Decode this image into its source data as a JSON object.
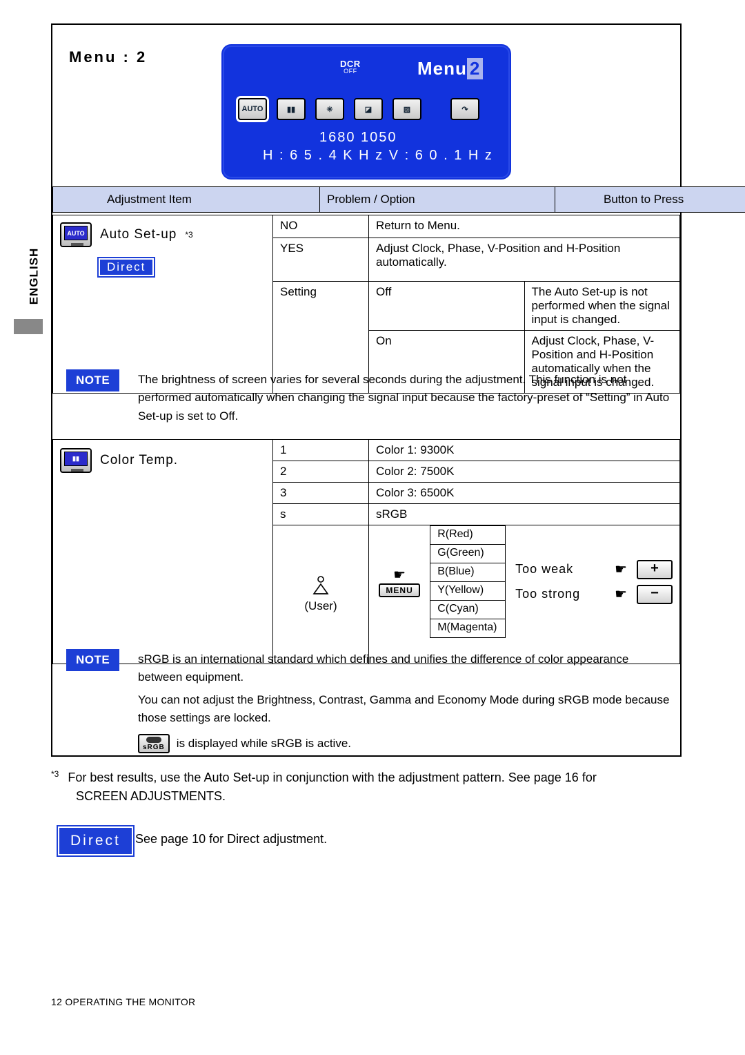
{
  "sidebar": {
    "language_tab": "ENGLISH"
  },
  "header": {
    "menu_title": "Menu : 2"
  },
  "osd": {
    "dcr_main": "DCR",
    "dcr_sub": "OFF",
    "menu_label": "Menu",
    "menu_number": "2",
    "resolution": "1680    1050",
    "frequency": "H : 6 5 . 4 K H z    V : 6 0 . 1 H z",
    "icons": [
      {
        "name": "auto-setup-icon",
        "glyph": "AUTO"
      },
      {
        "name": "color-temp-icon",
        "glyph": "▮▮"
      },
      {
        "name": "picture-adjust-icon",
        "glyph": "✳"
      },
      {
        "name": "contrast-icon",
        "glyph": "◪"
      },
      {
        "name": "misc-icon",
        "glyph": "▨"
      },
      {
        "name": "exit-icon",
        "glyph": "↷"
      }
    ]
  },
  "table_headers": {
    "adjustment_item": "Adjustment Item",
    "problem_option": "Problem / Option",
    "button_to_press": "Button to Press"
  },
  "auto_setup": {
    "label": "Auto Set-up",
    "footnote_marker": "*3",
    "direct_badge": "Direct",
    "rows": [
      {
        "option": "NO",
        "sub": "",
        "description": "Return to Menu."
      },
      {
        "option": "YES",
        "sub": "",
        "description": "Adjust Clock, Phase, V-Position and H-Position automatically."
      },
      {
        "option": "Setting",
        "sub": "Off",
        "description": "The Auto Set-up is not performed when the signal input is changed."
      },
      {
        "option": "",
        "sub": "On",
        "description": "Adjust Clock, Phase, V-Position and H-Position automatically when the signal input is changed."
      }
    ]
  },
  "note1": {
    "badge": "NOTE",
    "text": "The brightness of screen varies for several seconds during the adjustment. This function is not performed automatically when changing the signal input because the factory-preset of “Setting” in Auto Set-up is set to Off."
  },
  "color_temp": {
    "label": "Color Temp.",
    "rows": [
      {
        "option": "1",
        "description": "Color 1: 9300K"
      },
      {
        "option": "2",
        "description": "Color 2: 7500K"
      },
      {
        "option": "3",
        "description": "Color 3: 6500K"
      },
      {
        "option": "s",
        "description": "sRGB"
      }
    ],
    "user_label": "(User)",
    "menu_key": "MENU",
    "channels": [
      "R(Red)",
      "G(Green)",
      "B(Blue)",
      "Y(Yellow)",
      "C(Cyan)",
      "M(Magenta)"
    ],
    "too_weak": "Too weak",
    "too_strong": "Too strong",
    "plus": "+",
    "minus": "−"
  },
  "note2": {
    "badge": "NOTE",
    "line1": "sRGB is an international standard which defines and unifies the difference of color appearance between equipment.",
    "line2": "You can not adjust the Brightness, Contrast, Gamma and Economy Mode during sRGB mode because those settings are locked.",
    "line3_chip": "sRGB",
    "line3": "is displayed while sRGB is active."
  },
  "footnote": {
    "marker": "*3",
    "text": "For best results, use the Auto Set-up in conjunction with the adjustment pattern. See page 16 for",
    "text2": "SCREEN ADJUSTMENTS."
  },
  "direct_bottom": {
    "badge": "Direct",
    "text": "See page 10 for Direct adjustment."
  },
  "page_footer": {
    "text": "12   OPERATING THE MONITOR"
  }
}
